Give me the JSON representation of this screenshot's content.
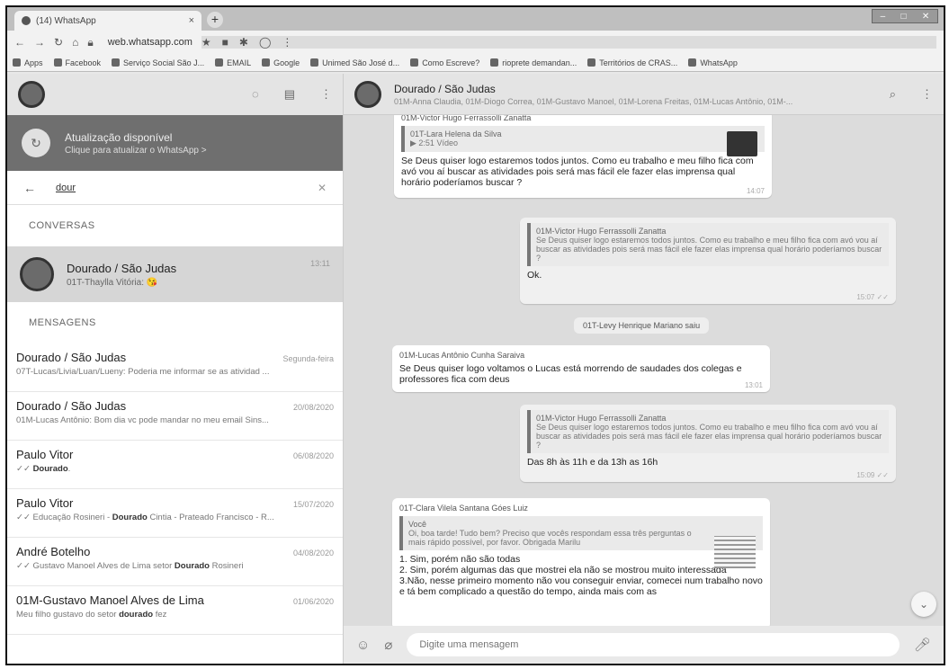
{
  "browser": {
    "tab_title": "(14) WhatsApp",
    "tab_close": "×",
    "new_tab": "+",
    "url": "web.whatsapp.com",
    "bookmarks": [
      "Apps",
      "Facebook",
      "Serviço Social São J...",
      "EMAIL",
      "Google",
      "Unimed São José d...",
      "Como Escreve?",
      "rioprete demandan...",
      "Territórios de CRAS...",
      "WhatsApp"
    ]
  },
  "sidebar": {
    "update_title": "Atualização disponível",
    "update_sub": "Clique para atualizar o WhatsApp >",
    "search_value": "dour",
    "section_conversations": "CONVERSAS",
    "conversation": {
      "name": "Dourado / São Judas",
      "preview": "01T-Thaylla Vitória: 😘",
      "time": "13:11"
    },
    "section_messages": "MENSAGENS",
    "messages": [
      {
        "name": "Dourado / São Judas",
        "date": "Segunda-feira",
        "pre": "07T-Lucas/Livia/Luan/Lueny: Poderia me informar se as atividad ...",
        "bold": "",
        "post": ""
      },
      {
        "name": "Dourado / São Judas",
        "date": "20/08/2020",
        "pre": "01M-Lucas Antônio: Bom dia vc pode mandar no meu email Sins...",
        "bold": "",
        "post": ""
      },
      {
        "name": "Paulo Vitor",
        "date": "06/08/2020",
        "pre": "✓✓ ",
        "bold": "Dourado",
        "post": "."
      },
      {
        "name": "Paulo Vitor",
        "date": "15/07/2020",
        "pre": "✓✓ Educação  Rosineri - ",
        "bold": "Dourado",
        "post": " Cintia - Prateado Francisco - R..."
      },
      {
        "name": "André Botelho",
        "date": "04/08/2020",
        "pre": "✓✓ Gustavo Manoel Alves de Lima setor ",
        "bold": "Dourado",
        "post": " Rosineri"
      },
      {
        "name": "01M-Gustavo Manoel Alves de Lima",
        "date": "01/06/2020",
        "pre": "Meu filho gustavo do setor ",
        "bold": "dourado",
        "post": " fez"
      }
    ]
  },
  "chat": {
    "title": "Dourado / São Judas",
    "members": "01M-Anna Claudia, 01M-Diogo Correa, 01M-Gustavo Manoel, 01M-Lorena Freitas, 01M-Lucas Antônio, 01M-...",
    "b1": {
      "top_sender": "01M-Victor Hugo Ferrassolli Zanatta",
      "quote_name": "01T-Lara Helena da Silva",
      "quote_text": "▶ 2:51 Vídeo",
      "text": "Se Deus quiser logo estaremos todos juntos. Como eu trabalho e meu filho fica com avó vou aí buscar as atividades pois será mas fácil ele fazer elas imprensa qual horário poderíamos buscar ?",
      "time": "14:07"
    },
    "b2": {
      "quote_name": "01M-Victor Hugo Ferrassolli Zanatta",
      "quote_text": "Se Deus quiser logo estaremos todos juntos. Como eu trabalho e meu filho fica com avó vou aí buscar as atividades pois será mas fácil ele fazer elas imprensa qual horário poderíamos buscar ?",
      "text": "Ok.",
      "time": "15:07 ✓✓"
    },
    "sys": "01T-Levy Henrique Mariano saiu",
    "b3": {
      "sender": "01M-Lucas Antônio Cunha Saraiva",
      "text": "Se Deus quiser logo voltamos o Lucas está morrendo de saudades dos colegas e professores fica com deus",
      "time": "13:01"
    },
    "b4": {
      "quote_name": "01M-Victor Hugo Ferrassolli Zanatta",
      "quote_text": "Se Deus quiser logo estaremos todos juntos. Como eu trabalho e meu filho fica com avó vou aí buscar as atividades pois será mas fácil ele fazer elas imprensa qual horário poderíamos buscar ?",
      "text": "Das 8h às 11h e da 13h as 16h",
      "time": "15:09 ✓✓"
    },
    "b5": {
      "sender": "01T-Clara Vilela Santana Góes Luiz",
      "quote_name": "Você",
      "quote_text": "Oi, boa tarde! Tudo bem? Preciso que vocês respondam essa três perguntas o mais rápido possível, por favor. Obrigada Marilu",
      "lines": [
        "1. Sim, porém não são todas",
        "2. Sim, porém algumas das que mostrei ela não se mostrou muito interessada",
        "3.Não, nesse primeiro momento não vou conseguir enviar, comecei num trabalho novo e tá bem complicado a questão do tempo, ainda mais com as"
      ]
    },
    "composer_placeholder": "Digite uma mensagem"
  }
}
